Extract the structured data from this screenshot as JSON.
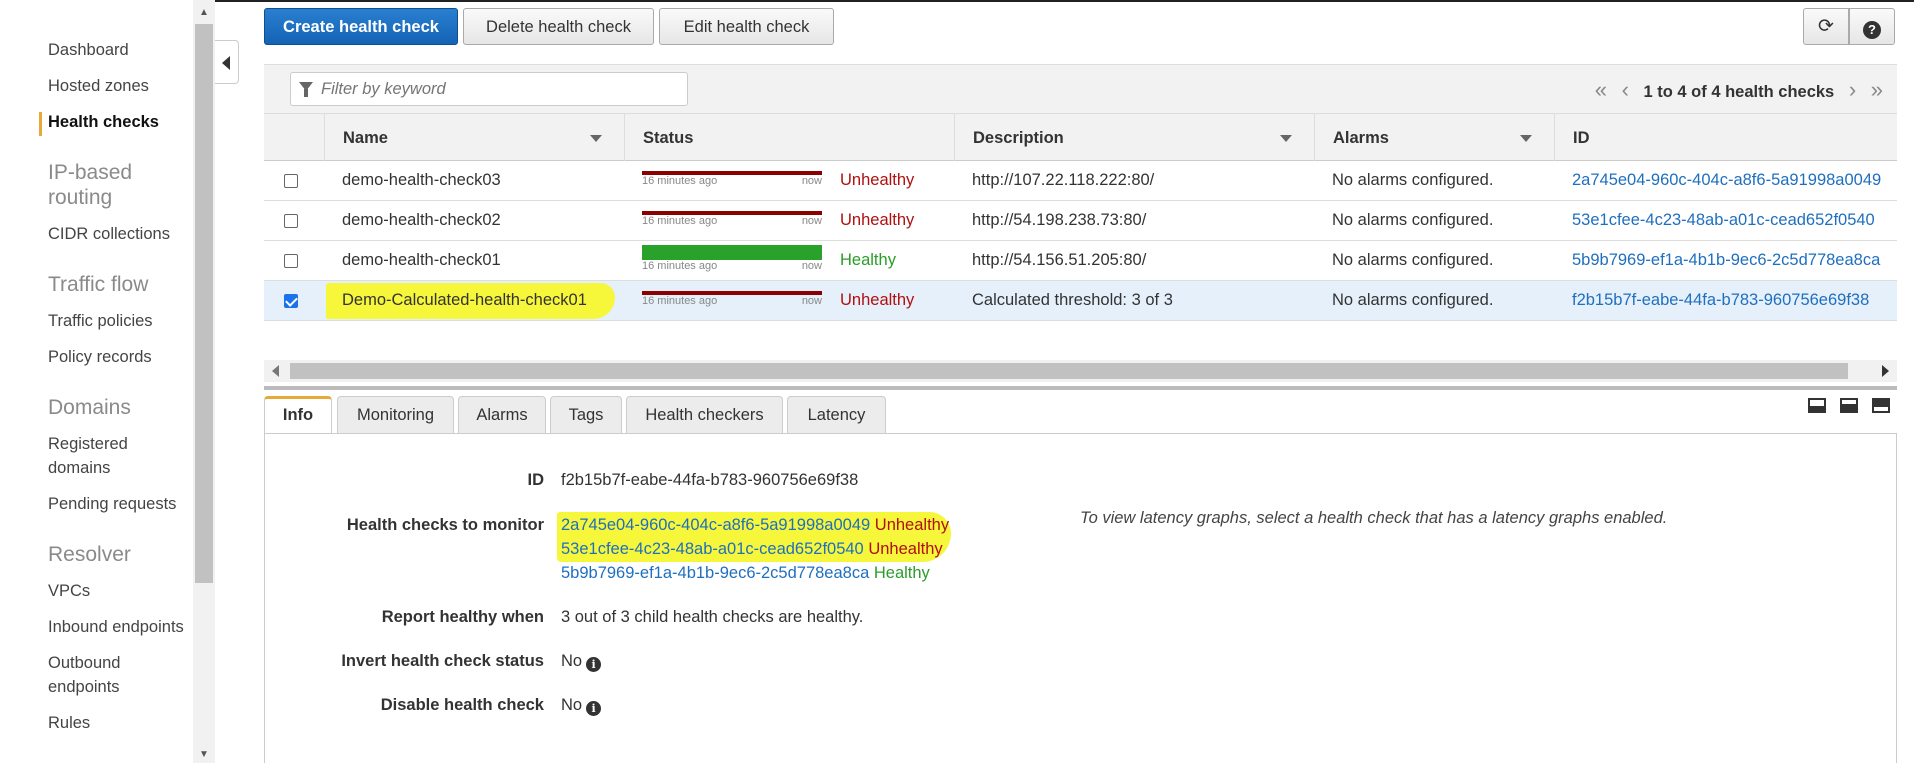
{
  "sidebar": {
    "items": [
      {
        "label": "Dashboard"
      },
      {
        "label": "Hosted zones"
      },
      {
        "label": "Health checks"
      }
    ],
    "ip_section": "IP-based routing",
    "cidr": "CIDR collections",
    "traffic_section": "Traffic flow",
    "traffic_policies": "Traffic policies",
    "policy_records": "Policy records",
    "domains_section": "Domains",
    "registered_domains": "Registered domains",
    "pending_requests": "Pending requests",
    "resolver_section": "Resolver",
    "vpcs": "VPCs",
    "inbound": "Inbound endpoints",
    "outbound": "Outbound endpoints",
    "rules": "Rules"
  },
  "toolbar": {
    "create": "Create health check",
    "delete": "Delete health check",
    "edit": "Edit health check",
    "refresh_icon": "refresh-icon",
    "help_icon": "help-icon"
  },
  "filter": {
    "placeholder": "Filter by keyword"
  },
  "pager": {
    "label": "1 to 4 of 4 health checks"
  },
  "table": {
    "columns": [
      "Name",
      "Status",
      "Description",
      "Alarms",
      "ID"
    ],
    "spark_left": "16 minutes ago",
    "spark_right": "now",
    "rows": [
      {
        "name": "demo-health-check03",
        "status": "Unhealthy",
        "description": "http://107.22.118.222:80/",
        "alarms": "No alarms configured.",
        "id": "2a745e04-960c-404c-a8f6-5a91998a0049",
        "selected": false
      },
      {
        "name": "demo-health-check02",
        "status": "Unhealthy",
        "description": "http://54.198.238.73:80/",
        "alarms": "No alarms configured.",
        "id": "53e1cfee-4c23-48ab-a01c-cead652f0540",
        "selected": false
      },
      {
        "name": "demo-health-check01",
        "status": "Healthy",
        "description": "http://54.156.51.205:80/",
        "alarms": "No alarms configured.",
        "id": "5b9b7969-ef1a-4b1b-9ec6-2c5d778ea8ca",
        "selected": false
      },
      {
        "name": "Demo-Calculated-health-check01",
        "status": "Unhealthy",
        "description": "Calculated threshold: 3 of 3",
        "alarms": "No alarms configured.",
        "id": "f2b15b7f-eabe-44fa-b783-960756e69f38",
        "selected": true
      }
    ]
  },
  "tabs": [
    "Info",
    "Monitoring",
    "Alarms",
    "Tags",
    "Health checkers",
    "Latency"
  ],
  "details": {
    "id_label": "ID",
    "id_value": "f2b15b7f-eabe-44fa-b783-960756e69f38",
    "monitor_label": "Health checks to monitor",
    "monitor": [
      {
        "id": "2a745e04-960c-404c-a8f6-5a91998a0049",
        "status": "Unhealthy"
      },
      {
        "id": "53e1cfee-4c23-48ab-a01c-cead652f0540",
        "status": "Unhealthy"
      },
      {
        "id": "5b9b7969-ef1a-4b1b-9ec6-2c5d778ea8ca",
        "status": "Healthy"
      }
    ],
    "report_label": "Report healthy when",
    "report_value": "3 out of 3 child health checks are healthy.",
    "invert_label": "Invert health check status",
    "invert_value": "No",
    "disable_label": "Disable health check",
    "disable_value": "No",
    "latency_note": "To view latency graphs, select a health check that has a latency graphs enabled."
  },
  "colors": {
    "primary": "#1463b5",
    "unhealthy": "#b01010",
    "healthy": "#2a9d2a",
    "highlight": "#f6f63a",
    "link": "#1f6fbf"
  }
}
